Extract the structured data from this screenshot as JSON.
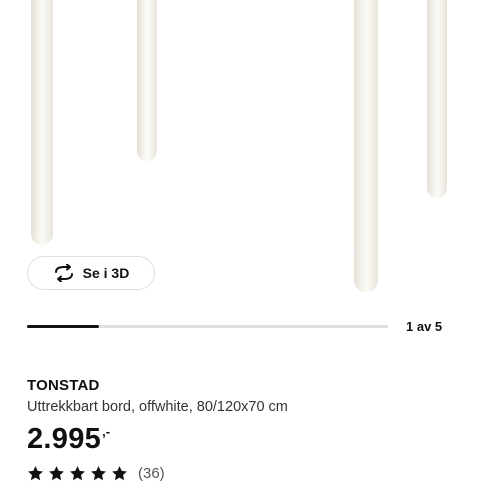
{
  "gallery": {
    "view_3d_label": "Se i 3D",
    "current_image": 1,
    "total_images": 5,
    "pager_text": "1 av 5"
  },
  "product": {
    "name": "TONSTAD",
    "description": "Uttrekkbart bord, offwhite, 80/120x70 cm",
    "price": "2.995",
    "price_suffix": ",-",
    "rating": 5,
    "review_count": "(36)"
  },
  "icons": {
    "view_3d": "rotate-3d-icon",
    "star": "star-icon"
  },
  "colors": {
    "text": "#111111",
    "progress_track": "#dfdfdf",
    "progress_fill": "#111111",
    "table_leg": "#f6f4ee"
  }
}
